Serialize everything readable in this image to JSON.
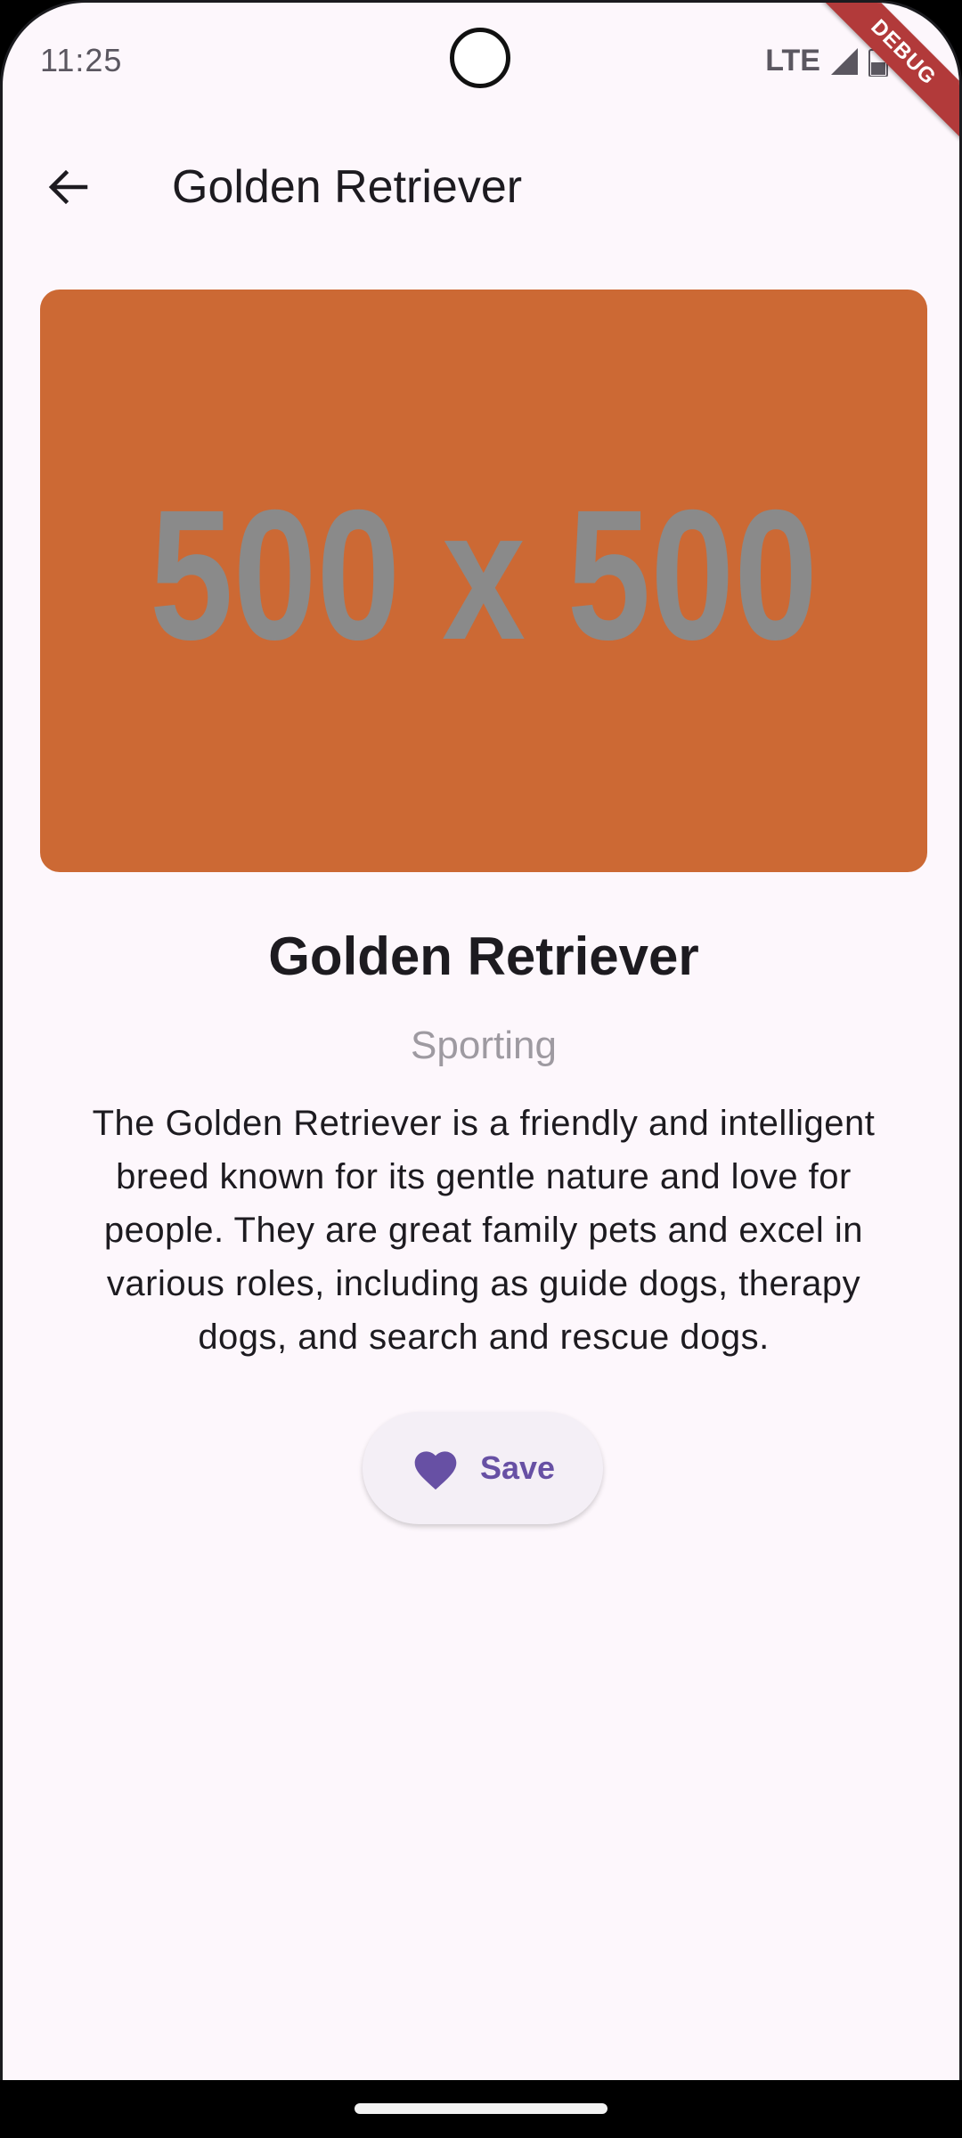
{
  "status_bar": {
    "time": "11:25",
    "network": "LTE",
    "debug_banner": "DEBUG"
  },
  "app_bar": {
    "title": "Golden Retriever",
    "back_icon": "arrow-back-icon"
  },
  "hero_image": {
    "placeholder_text": "500 x 500",
    "background_color": "#cc6934",
    "text_color": "#8a8a8a"
  },
  "breed": {
    "name": "Golden Retriever",
    "group": "Sporting",
    "description": "The Golden Retriever is a friendly and intelligent breed known for its gentle nature and love for people. They are great family pets and excel in various roles, including as guide dogs, therapy dogs, and search and rescue dogs."
  },
  "save_button": {
    "label": "Save",
    "icon": "heart-icon",
    "accent_color": "#6750a4"
  },
  "colors": {
    "background": "#fdf7fc",
    "text_primary": "#1d1b20",
    "text_secondary": "#9e9aa1"
  }
}
